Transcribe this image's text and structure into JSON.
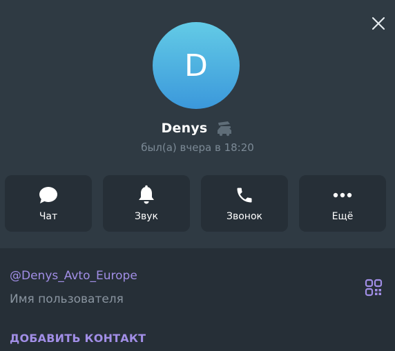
{
  "profile": {
    "avatar_letter": "D",
    "name": "Denys",
    "last_seen": "был(а) вчера в 18:20",
    "emoji_status_icon": "car-icon"
  },
  "actions": [
    {
      "label": "Чат",
      "icon": "chat-bubble-icon"
    },
    {
      "label": "Звук",
      "icon": "bell-icon"
    },
    {
      "label": "Звонок",
      "icon": "phone-icon"
    },
    {
      "label": "Ещё",
      "icon": "more-dots-icon"
    }
  ],
  "info": {
    "username": "@Denys_Avto_Europe",
    "username_caption": "Имя пользователя",
    "add_contact_label": "ДОБАВИТЬ КОНТАКТ"
  },
  "colors": {
    "accent": "#a18ee6",
    "header_bg": "#2f3a43",
    "panel_bg": "#262f37",
    "avatar_top": "#63cbe6",
    "avatar_bottom": "#3b98db"
  }
}
